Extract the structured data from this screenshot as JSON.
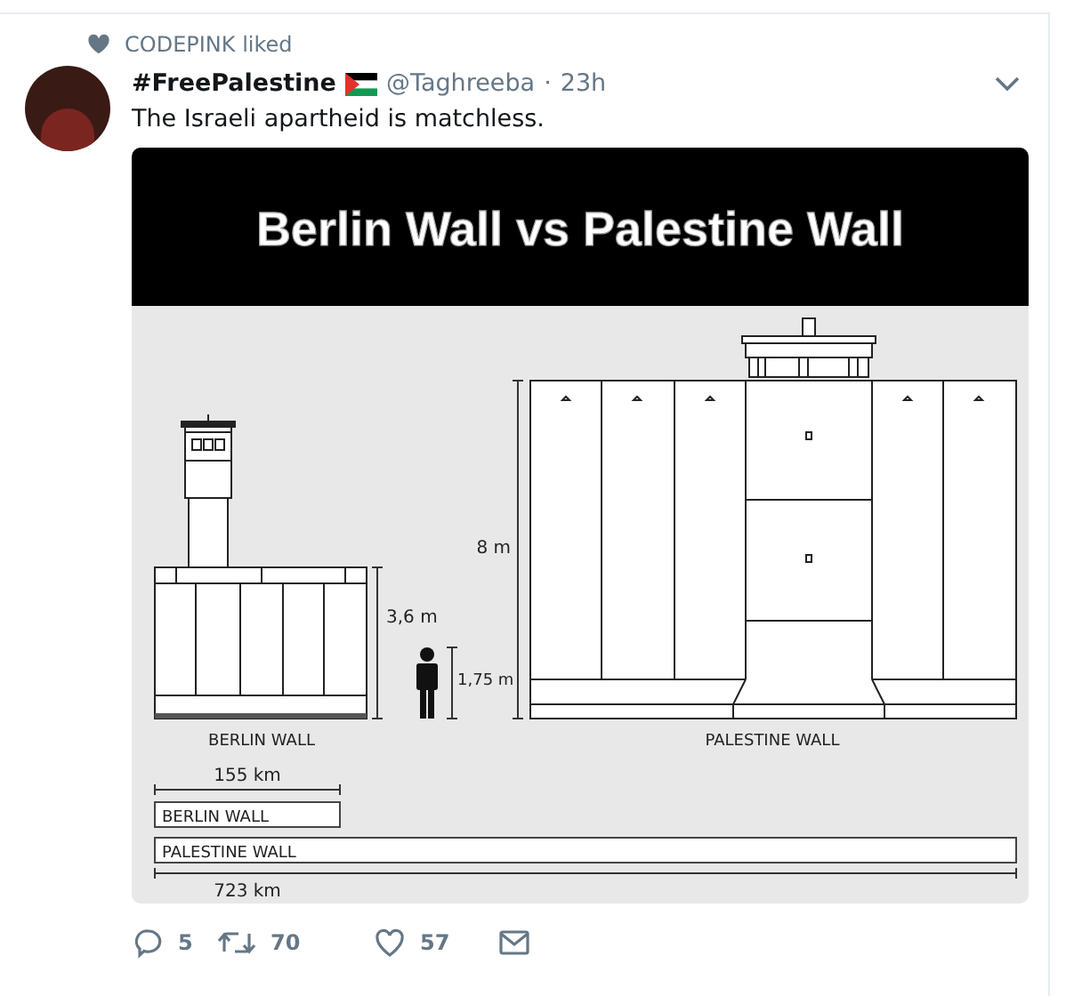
{
  "context": {
    "text": "CODEPINK liked"
  },
  "tweet": {
    "name": "#FreePalestine",
    "handle": "@Taghreeba",
    "separator": "·",
    "time": "23h",
    "text": "The Israeli apartheid is matchless.",
    "media": {
      "title": "Berlin Wall vs Palestine Wall",
      "labels": [
        "3,6 m",
        "8 m",
        "1,75 m",
        "BERLIN WALL",
        "PALESTINE WALL",
        "155 km",
        "BERLIN WALL",
        "PALESTINE WALL",
        "723 km"
      ]
    },
    "actions": [
      {
        "kind": "reply",
        "count": "5"
      },
      {
        "kind": "retweet",
        "count": "70"
      },
      {
        "kind": "like",
        "count": "57"
      },
      {
        "kind": "message"
      }
    ]
  }
}
